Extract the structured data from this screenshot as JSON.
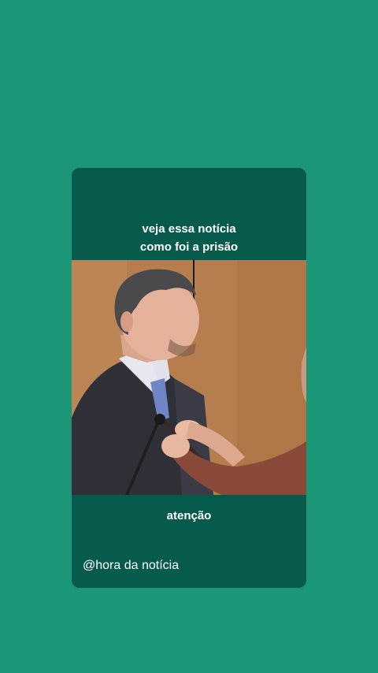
{
  "post": {
    "headline_line1": "veja essa notícia",
    "headline_line2": "como foi a prisão",
    "caption": "atenção",
    "handle": "@hora da notícia"
  },
  "colors": {
    "background": "#1b9677",
    "card": "#075b4c",
    "text": "#ffffff"
  }
}
